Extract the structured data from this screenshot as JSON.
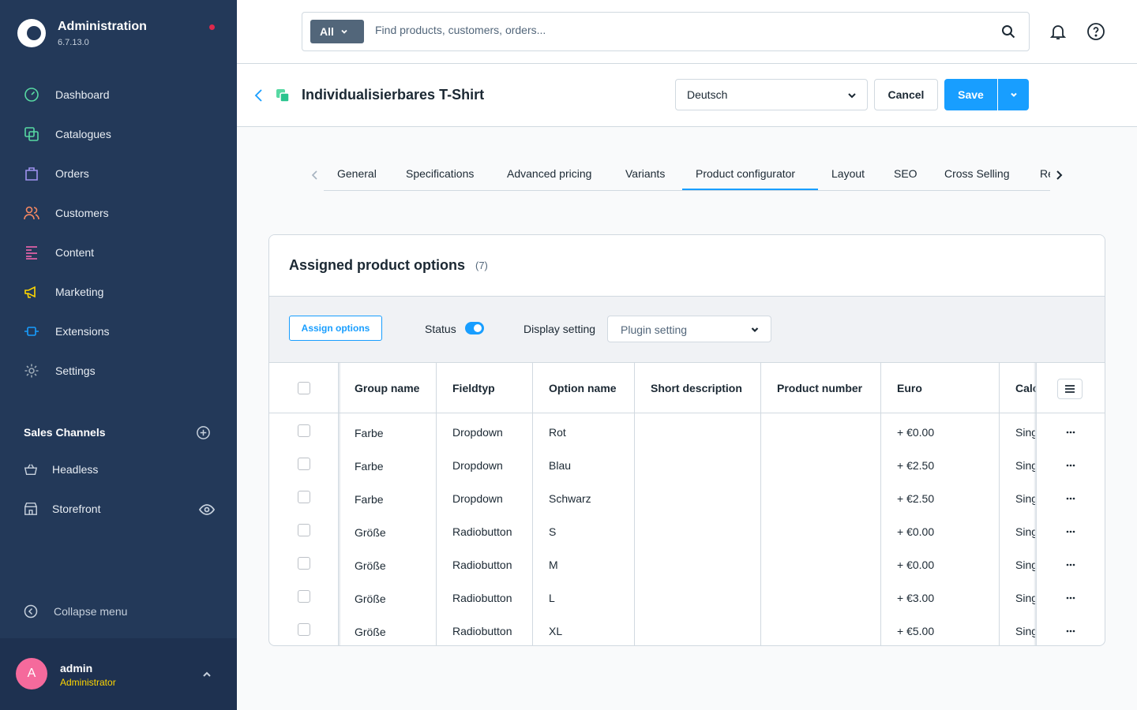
{
  "app": {
    "title": "Administration",
    "version": "6.7.13.0"
  },
  "nav": {
    "items": [
      {
        "label": "Dashboard",
        "icon": "dashboard-icon",
        "color": "#57d9a3"
      },
      {
        "label": "Catalogues",
        "icon": "catalogue-icon",
        "color": "#57d9a3"
      },
      {
        "label": "Orders",
        "icon": "orders-icon",
        "color": "#a092f0"
      },
      {
        "label": "Customers",
        "icon": "customers-icon",
        "color": "#f88962"
      },
      {
        "label": "Content",
        "icon": "content-icon",
        "color": "#ff68b4"
      },
      {
        "label": "Marketing",
        "icon": "marketing-icon",
        "color": "#ffd700"
      },
      {
        "label": "Extensions",
        "icon": "extensions-icon",
        "color": "#189eff"
      },
      {
        "label": "Settings",
        "icon": "settings-icon",
        "color": "#9aa8b5"
      }
    ]
  },
  "sales_channels": {
    "title": "Sales Channels",
    "items": [
      {
        "label": "Headless",
        "icon": "basket-icon"
      },
      {
        "label": "Storefront",
        "icon": "storefront-icon"
      }
    ]
  },
  "sidebar_footer": {
    "collapse_label": "Collapse menu",
    "user": {
      "initial": "A",
      "name": "admin",
      "role": "Administrator"
    }
  },
  "search": {
    "type_label": "All",
    "placeholder": "Find products, customers, orders..."
  },
  "smartbar": {
    "title": "Individualisierbares T-Shirt",
    "language": "Deutsch",
    "cancel_label": "Cancel",
    "save_label": "Save"
  },
  "tabs": [
    {
      "label": "General"
    },
    {
      "label": "Specifications"
    },
    {
      "label": "Advanced pricing"
    },
    {
      "label": "Variants"
    },
    {
      "label": "Product configurator",
      "active": true
    },
    {
      "label": "Layout"
    },
    {
      "label": "SEO"
    },
    {
      "label": "Cross Selling"
    },
    {
      "label": "Reviews"
    }
  ],
  "card": {
    "title": "Assigned product options",
    "count": "(7)",
    "assign_label": "Assign options",
    "status_label": "Status",
    "status_on": true,
    "display_label": "Display setting",
    "display_value": "Plugin setting"
  },
  "table": {
    "columns": [
      "Group name",
      "Fieldtyp",
      "Option name",
      "Short description",
      "Product number",
      "Euro",
      "Calculation"
    ],
    "rows": [
      {
        "group": "Farbe",
        "fieldtype": "Dropdown",
        "option": "Rot",
        "short": "",
        "number": "",
        "euro": "+ €0.00",
        "calc": "Single"
      },
      {
        "group": "Farbe",
        "fieldtype": "Dropdown",
        "option": "Blau",
        "short": "",
        "number": "",
        "euro": "+ €2.50",
        "calc": "Single"
      },
      {
        "group": "Farbe",
        "fieldtype": "Dropdown",
        "option": "Schwarz",
        "short": "",
        "number": "",
        "euro": "+ €2.50",
        "calc": "Single"
      },
      {
        "group": "Größe",
        "fieldtype": "Radiobutton",
        "option": "S",
        "short": "",
        "number": "",
        "euro": "+ €0.00",
        "calc": "Single"
      },
      {
        "group": "Größe",
        "fieldtype": "Radiobutton",
        "option": "M",
        "short": "",
        "number": "",
        "euro": "+ €0.00",
        "calc": "Single"
      },
      {
        "group": "Größe",
        "fieldtype": "Radiobutton",
        "option": "L",
        "short": "",
        "number": "",
        "euro": "+ €3.00",
        "calc": "Single"
      },
      {
        "group": "Größe",
        "fieldtype": "Radiobutton",
        "option": "XL",
        "short": "",
        "number": "",
        "euro": "+ €5.00",
        "calc": "Single"
      }
    ]
  }
}
